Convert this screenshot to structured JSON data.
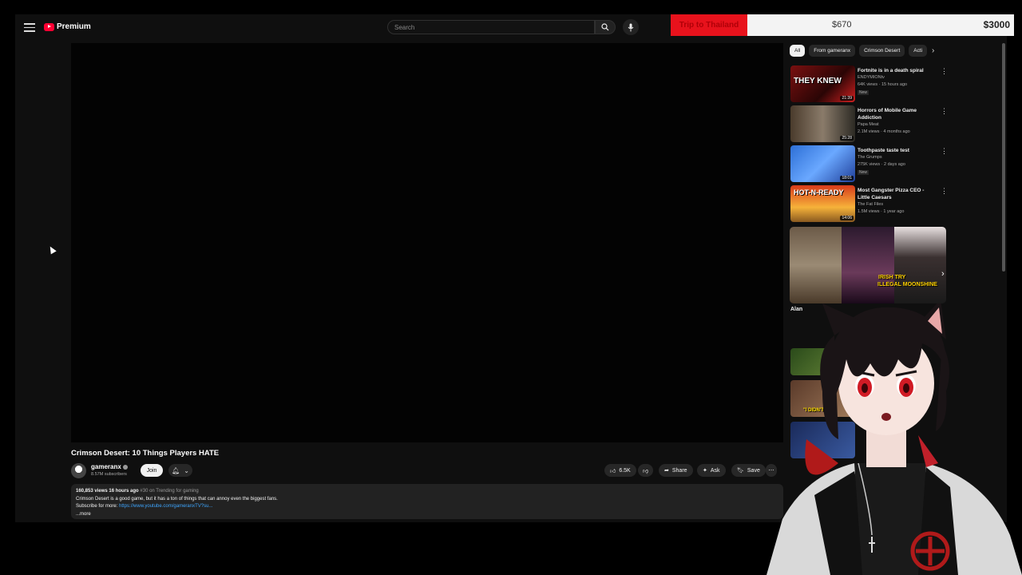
{
  "header": {
    "logo_label": "Premium",
    "search_placeholder": "Search"
  },
  "tracker": {
    "label": "Trip to Thailand",
    "current": "$670",
    "goal": "$3000"
  },
  "video": {
    "title": "Crimson Desert: 10 Things Players HATE",
    "channel": "gameranx",
    "subscribers": "8.57M subscribers",
    "join_label": "Join",
    "likes": "6.5K",
    "share_label": "Share",
    "ask_label": "Ask",
    "save_label": "Save",
    "meta": "160,853 views  16 hours ago",
    "trending": "#30 on Trending for gaming",
    "description": "Crimson Desert is a good game, but it has a ton of things that can annoy even the biggest fans.",
    "subscribe_text": "Subscribe for more: ",
    "subscribe_link": "https://www.youtube.com/gameranxTV?su...",
    "more_label": "...more"
  },
  "chips": [
    "All",
    "From gameranx",
    "Crimson Desert",
    "Acti"
  ],
  "recommendations": [
    {
      "title": "Fortnite is in a death spiral",
      "channel": "ENDYMIONtv",
      "views": "64K views · 15 hours ago",
      "badge": "New",
      "duration": "21:39",
      "thumb_text": "THEY KNEW"
    },
    {
      "title": "Horrors of Mobile Game Addiction",
      "channel": "Papa Meat",
      "views": "2.1M views · 4 months ago",
      "badge": "",
      "duration": "25:28",
      "thumb_text": ""
    },
    {
      "title": "Toothpaste taste test",
      "channel": "The Grumps",
      "views": "275K views · 2 days ago",
      "badge": "New",
      "duration": "18:01",
      "thumb_text": ""
    },
    {
      "title": "Most Gangster Pizza CEO - Little Caesars",
      "channel": "The Fat Files",
      "views": "1.5M views · 1 year ago",
      "badge": "",
      "duration": "14:06",
      "thumb_text": "HOT-N-READY"
    }
  ],
  "shelf": {
    "text_1": "IRISH TRY",
    "text_2": "ILLEGAL MOONSHINE"
  },
  "partial_title": "Alan",
  "thumb_text_5": "\"I DIDN'T D..."
}
